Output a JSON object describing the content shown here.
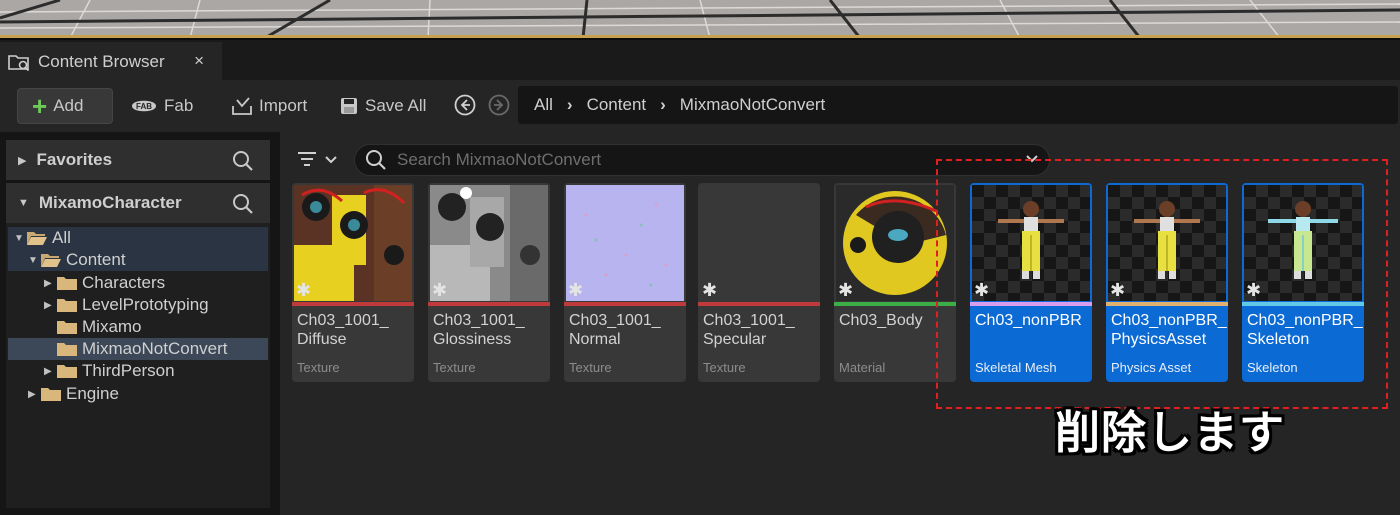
{
  "window": {
    "tab_title": "Content Browser",
    "tab_close": "×"
  },
  "toolbar": {
    "add_label": "Add",
    "fab_label": "Fab",
    "import_label": "Import",
    "saveall_label": "Save All"
  },
  "breadcrumb": [
    "All",
    "Content",
    "MixmaoNotConvert"
  ],
  "sidebar": {
    "favorites_label": "Favorites",
    "project_label": "MixamoCharacter",
    "tree": [
      {
        "label": "All",
        "expanded": true
      },
      {
        "label": "Content",
        "expanded": true
      },
      {
        "label": "Characters",
        "expanded": false
      },
      {
        "label": "LevelPrototyping",
        "expanded": false
      },
      {
        "label": "Mixamo"
      },
      {
        "label": "MixmaoNotConvert",
        "selected": true
      },
      {
        "label": "ThirdPerson",
        "expanded": false
      },
      {
        "label": "Engine",
        "expanded": false
      }
    ]
  },
  "search": {
    "placeholder": "Search MixmaoNotConvert"
  },
  "assets": [
    {
      "name": "Ch03_1001_\nDiffuse",
      "type": "Texture",
      "color": "#c0393b",
      "selected": false
    },
    {
      "name": "Ch03_1001_\nGlossiness",
      "type": "Texture",
      "color": "#c0393b",
      "selected": false
    },
    {
      "name": "Ch03_1001_\nNormal",
      "type": "Texture",
      "color": "#c0393b",
      "selected": false
    },
    {
      "name": "Ch03_1001_\nSpecular",
      "type": "Texture",
      "color": "#c0393b",
      "selected": false
    },
    {
      "name": "Ch03_Body",
      "type": "Material",
      "color": "#3cae45",
      "selected": false
    },
    {
      "name": "Ch03_nonPBR",
      "type": "Skeletal Mesh",
      "color": "#d89cf0",
      "selected": true
    },
    {
      "name": "Ch03_nonPBR_\nPhysicsAsset",
      "type": "Physics Asset",
      "color": "#e0b070",
      "selected": true
    },
    {
      "name": "Ch03_nonPBR_\nSkeleton",
      "type": "Skeleton",
      "color": "#62c8e8",
      "selected": true
    }
  ],
  "annotation": {
    "text": "削除します",
    "border_color": "#e02020"
  },
  "colors": {
    "accent_selected": "#0c6ad4",
    "add_plus": "#6ec85a"
  }
}
